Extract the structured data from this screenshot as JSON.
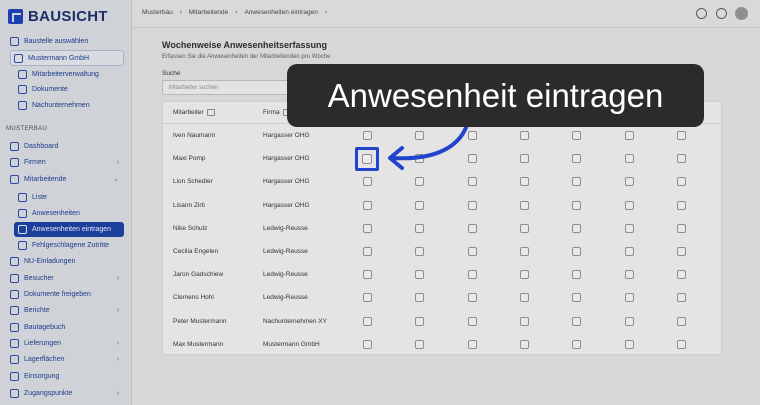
{
  "app": {
    "name": "BAUSICHT"
  },
  "sidebar": {
    "select_site": "Baustelle auswählen",
    "company": "Mustermann GmbH",
    "company_items": [
      "Mitarbeiterverwaltung",
      "Dokumente",
      "Nachunternehmen"
    ],
    "section_label": "MUSTERBAU",
    "items": [
      {
        "label": "Dashboard",
        "icon": "dashboard-icon"
      },
      {
        "label": "Firmen",
        "icon": "building-icon"
      },
      {
        "label": "Mitarbeitende",
        "icon": "people-icon"
      },
      {
        "label": "Liste",
        "icon": "list-icon"
      },
      {
        "label": "Anwesenheiten",
        "icon": "clock-icon"
      },
      {
        "label": "Anwesenheiten eintragen",
        "icon": "edit-icon"
      },
      {
        "label": "Fehlgeschlagene Zutritte",
        "icon": "blocked-icon"
      },
      {
        "label": "NU-Einladungen",
        "icon": "invite-icon"
      },
      {
        "label": "Besucher",
        "icon": "visitor-icon"
      },
      {
        "label": "Dokumente freigeben",
        "icon": "document-icon"
      },
      {
        "label": "Berichte",
        "icon": "report-icon"
      },
      {
        "label": "Bautagebuch",
        "icon": "book-icon"
      },
      {
        "label": "Lieferungen",
        "icon": "truck-icon"
      },
      {
        "label": "Lagerflächen",
        "icon": "storage-icon"
      },
      {
        "label": "Einsorgung",
        "icon": "recycle-icon"
      },
      {
        "label": "Zugangspunkte",
        "icon": "gate-icon"
      }
    ]
  },
  "topbar": {
    "breadcrumbs": [
      "Musterbau",
      "›",
      "Mitarbeitende",
      "›",
      "Anwesenheiten eintragen",
      "›"
    ]
  },
  "main": {
    "title": "Wochenweise Anwesenheitserfassung",
    "subtitle": "Erfassen Sie die Anwesenheiten der Mitarbeitenden pro Woche",
    "search_label": "Suche",
    "search_placeholder": "Mitarbeiter suchen",
    "columns": [
      "Mitarbeiter",
      "Firma"
    ],
    "rows": [
      {
        "name": "Iven Naumann",
        "company": "Hargasser OHG"
      },
      {
        "name": "Maxi Pomp",
        "company": "Hargasser OHG"
      },
      {
        "name": "Lion Schedler",
        "company": "Hargasser OHG"
      },
      {
        "name": "Lisann Zirti",
        "company": "Hargasser OHG"
      },
      {
        "name": "Nike Schulz",
        "company": "Ledwig-Reusse"
      },
      {
        "name": "Cecilia Engelen",
        "company": "Ledwig-Reusse"
      },
      {
        "name": "Jaron Gadschiew",
        "company": "Ledwig-Reusse"
      },
      {
        "name": "Clemens Hohl",
        "company": "Ledwig-Reusse"
      },
      {
        "name": "Peter Mustermann",
        "company": "Nachunternehmen XY"
      },
      {
        "name": "Max Mustermann",
        "company": "Mustermann GmbH"
      }
    ]
  },
  "overlay": {
    "text": "Anwesenheit eintragen"
  },
  "colors": {
    "accent": "#1c3f9c",
    "highlight": "#2244cc",
    "overlay_bg": "#2b2b2b"
  }
}
